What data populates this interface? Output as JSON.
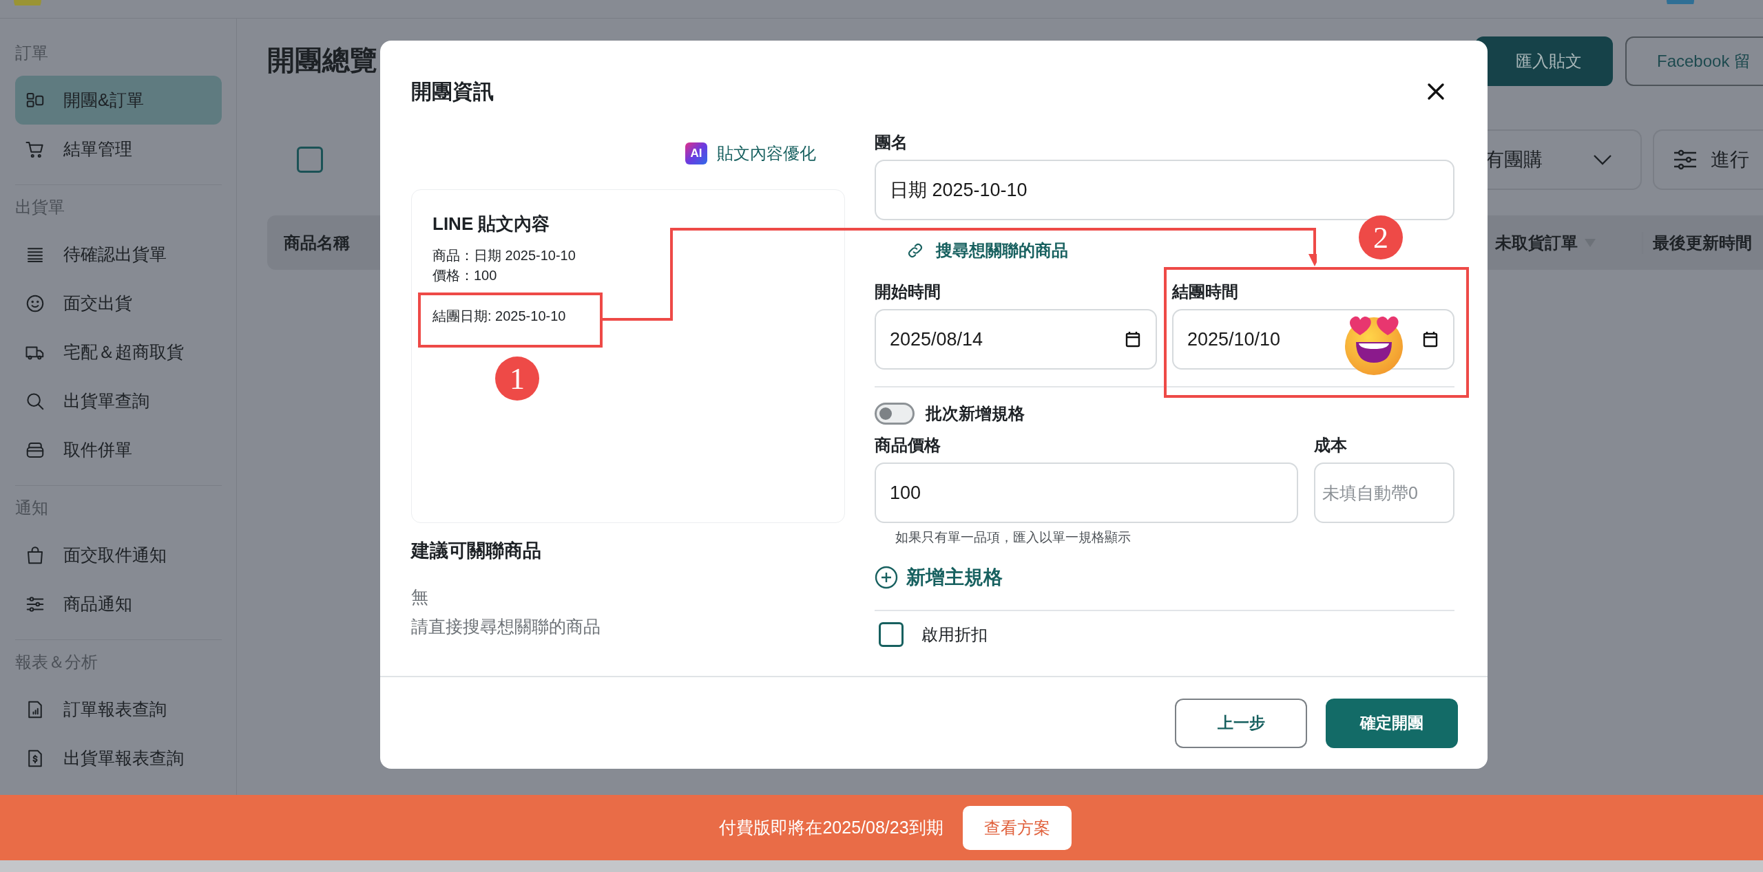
{
  "sidebar": {
    "sections": [
      {
        "title": "訂單",
        "items": [
          {
            "label": "開團&訂單",
            "selected": true
          },
          {
            "label": "結單管理",
            "selected": false
          }
        ]
      },
      {
        "title": "出貨單",
        "items": [
          {
            "label": "待確認出貨單",
            "selected": false
          },
          {
            "label": "面交出貨",
            "selected": false
          },
          {
            "label": "宅配＆超商取貨",
            "selected": false
          },
          {
            "label": "出貨單查詢",
            "selected": false
          },
          {
            "label": "取件併單",
            "selected": false
          }
        ]
      },
      {
        "title": "通知",
        "items": [
          {
            "label": "面交取件通知",
            "selected": false
          },
          {
            "label": "商品通知",
            "selected": false
          }
        ]
      },
      {
        "title": "報表＆分析",
        "items": [
          {
            "label": "訂單報表查詢",
            "selected": false
          },
          {
            "label": "出貨單報表查詢",
            "selected": false
          }
        ]
      }
    ]
  },
  "page": {
    "title": "開團總覽",
    "buttons": [
      {
        "label": "匯入貼文",
        "kind": "primary"
      },
      {
        "label": "Facebook 留",
        "kind": "outline"
      }
    ],
    "select_all": {
      "checked": false
    },
    "filter_dropdown": "有團購",
    "filter_button": "進行",
    "columns": [
      {
        "label": "商品名稱",
        "sort_arrow": false
      },
      {
        "label": "未取貨訂單",
        "sort_arrow": true
      },
      {
        "label": "最後更新時間",
        "sort_arrow": false
      }
    ]
  },
  "modal": {
    "title": "開團資訊",
    "ai_badge": "AI",
    "ai_link": "貼文內容優化",
    "post_card": {
      "title": "LINE 貼文內容",
      "lines": [
        "商品：日期 2025-10-10",
        "價格：100",
        "結團日期: 2025-10-10"
      ]
    },
    "suggestions": {
      "title": "建議可關聯商品",
      "lines": [
        "無",
        "請直接搜尋想關聯的商品"
      ]
    },
    "group_name": {
      "label": "團名",
      "value": "日期 2025-10-10"
    },
    "search_link": "搜尋想關聯的商品",
    "start_time": {
      "label": "開始時間",
      "value": "2025/08/14"
    },
    "end_time": {
      "label": "結團時間",
      "value": "2025/10/10"
    },
    "batch_toggle": {
      "label": "批次新增規格",
      "on": false
    },
    "price": {
      "label": "商品價格",
      "value": "100"
    },
    "cost": {
      "label": "成本",
      "placeholder": "未填自動帶0"
    },
    "hint": "如果只有單一品項，匯入以單一規格顯示",
    "add_spec": "新增主規格",
    "discount": {
      "label": "啟用折扣",
      "checked": false
    },
    "footer_buttons": [
      {
        "label": "上一步",
        "kind": "outline"
      },
      {
        "label": "確定開團",
        "kind": "primary"
      }
    ]
  },
  "annotations": [
    {
      "number": "1"
    },
    {
      "number": "2"
    }
  ],
  "banner": {
    "text": "付費版即將在2025/08/23到期",
    "button": "查看方案"
  }
}
